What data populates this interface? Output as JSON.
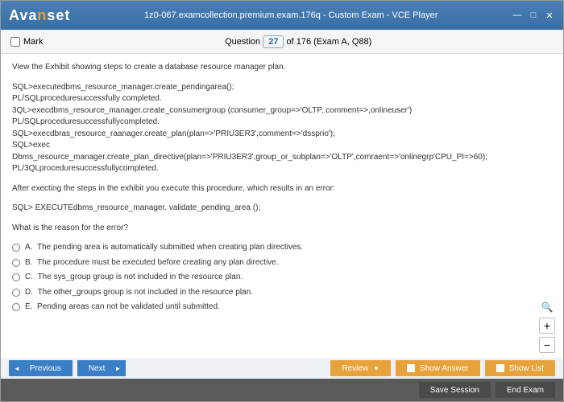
{
  "window": {
    "logo_pre": "Ava",
    "logo_mid": "n",
    "logo_post": "set",
    "title": "1z0-067.examcollection.premium.exam.176q - Custom Exam - VCE Player"
  },
  "header": {
    "mark_label": "Mark",
    "question_word": "Question",
    "question_num": "27",
    "question_rest": " of 176 (Exam A, Q88)"
  },
  "body": {
    "intro": "View the Exhibit showing steps to create a database resource manager plan.",
    "code": [
      "SQL>executedbms_resource_manager.create_pendingarea();",
      "PL/SQLproceduresuccessfully completed.",
      "3QL>execdbms_resource_manager.create_consumergroup (consumer_group=>'OLTP,.comment=>,onlineuser')",
      "PL/SQLproceduresuccessfullycompleted.",
      "SQL>execdbras_resource_raanager.create_plan(plan=>'PRIU3ER3',comment=>'dssprio');",
      "SQL>exec",
      "Dbms_resource_manager.create_plan_directive(plan=>'PRIU3ER3',group_or_subplan=>'OLTP',comraent=>'onlinegrp'CPU_PI=>60);",
      "PL/3QLproceduresuccessfullycompleted."
    ],
    "after": "After execting the steps in the exhibit you execute this procedure, which results in an error:",
    "exec_line": "SQL> EXECUTEdbms_resource_manager. validate_pending_area ();",
    "question": "What is the reason for the error?",
    "options": [
      {
        "letter": "A.",
        "text": "The pending area is automatically submitted when creating plan directives."
      },
      {
        "letter": "B.",
        "text": "The procedure must be executed before creating any plan directive."
      },
      {
        "letter": "C.",
        "text": "The sys_group group is not included in the resource plan."
      },
      {
        "letter": "D.",
        "text": "The other_groups group is not included in the resource plan."
      },
      {
        "letter": "E.",
        "text": "Pending areas can not be validated until submitted."
      }
    ]
  },
  "toolbar": {
    "previous": "Previous",
    "next": "Next",
    "review": "Review",
    "show_answer": "Show Answer",
    "show_list": "Show List",
    "save_session": "Save Session",
    "end_exam": "End Exam"
  }
}
